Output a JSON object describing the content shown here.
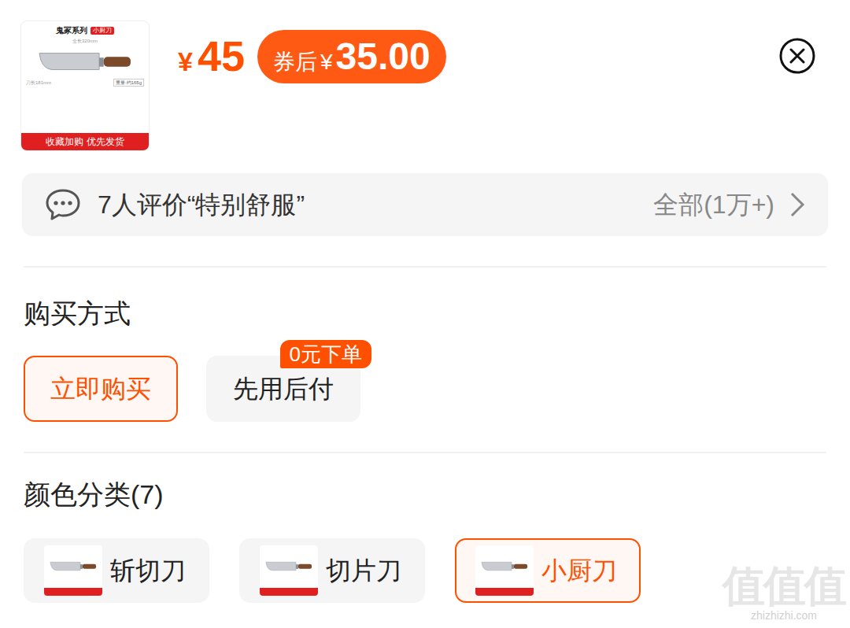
{
  "product": {
    "thumbnail": {
      "series": "鬼冢系列",
      "tag": "小厨刀",
      "length": "全长320mm",
      "blade_length": "刀长181mm",
      "weight": "重量:约165g",
      "banner": "收藏加购 优先发货"
    },
    "price": {
      "currency": "¥",
      "amount": "45"
    },
    "coupon": {
      "label": "券后",
      "currency": "¥",
      "amount": "35.00"
    }
  },
  "reviews": {
    "summary": "7人评价“特别舒服”",
    "all": "全部(1万+)"
  },
  "purchase": {
    "title": "购买方式",
    "options": [
      {
        "label": "立即购买",
        "selected": true
      },
      {
        "label": "先用后付",
        "selected": false,
        "badge": "0元下单"
      }
    ]
  },
  "variants": {
    "title": "颜色分类(7)",
    "options": [
      {
        "label": "斩切刀",
        "selected": false
      },
      {
        "label": "切片刀",
        "selected": false
      },
      {
        "label": "小厨刀",
        "selected": true
      }
    ]
  },
  "watermark": {
    "logo": "值值值",
    "url": "zhizhizhi.com"
  }
}
